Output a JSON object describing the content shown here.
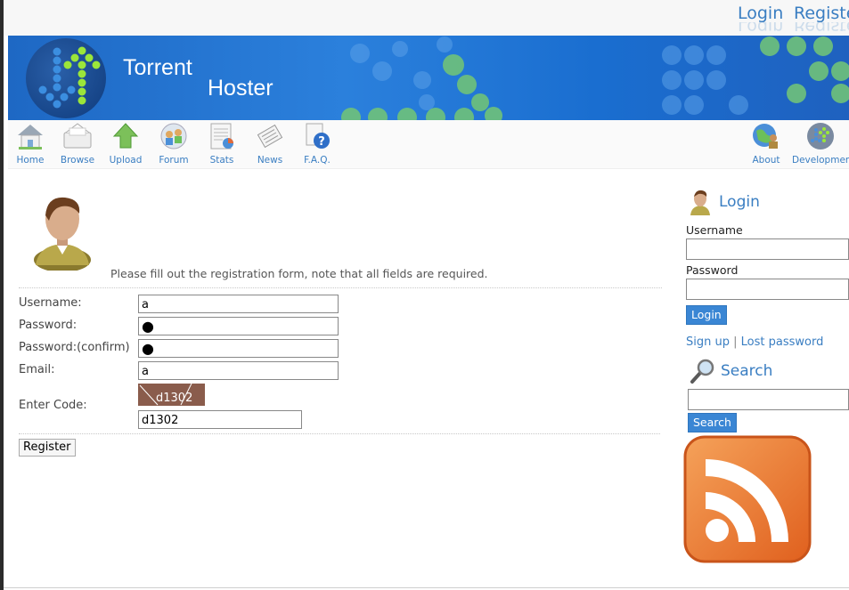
{
  "topnav": {
    "login": "Login",
    "register": "Registe"
  },
  "brand": {
    "line1": "Torrent",
    "line2": "Hoster"
  },
  "toolbar": {
    "items": [
      {
        "label": "Home",
        "icon": "home-icon"
      },
      {
        "label": "Browse",
        "icon": "browse-icon"
      },
      {
        "label": "Upload",
        "icon": "upload-icon"
      },
      {
        "label": "Forum",
        "icon": "forum-icon"
      },
      {
        "label": "Stats",
        "icon": "stats-icon"
      },
      {
        "label": "News",
        "icon": "news-icon"
      },
      {
        "label": "F.A.Q.",
        "icon": "faq-icon"
      }
    ],
    "right_items": [
      {
        "label": "About",
        "icon": "about-icon"
      },
      {
        "label": "Development",
        "icon": "development-icon"
      }
    ]
  },
  "register": {
    "intro": "Please fill out the registration form, note that all fields are required.",
    "fields": {
      "username_label": "Username:",
      "username_value": "a",
      "password_label": "Password:",
      "password_value": "●",
      "password_confirm_label": "Password:(confirm)",
      "password_confirm_value": "●",
      "email_label": "Email:",
      "email_value": "a",
      "code_label": "Enter Code:",
      "captcha_text": "d1302",
      "code_value": "d1302"
    },
    "submit_label": "Register"
  },
  "sidebar": {
    "login_title": "Login",
    "username_label": "Username",
    "password_label": "Password",
    "login_button": "Login",
    "signup_link": "Sign up",
    "link_separator": "|",
    "lost_password_link": "Lost password",
    "search_title": "Search",
    "search_button": "Search"
  },
  "colors": {
    "accent": "#3a7ec2",
    "banner": "#1e68c4",
    "button": "#3a86d4",
    "rss": "#e8702a"
  }
}
